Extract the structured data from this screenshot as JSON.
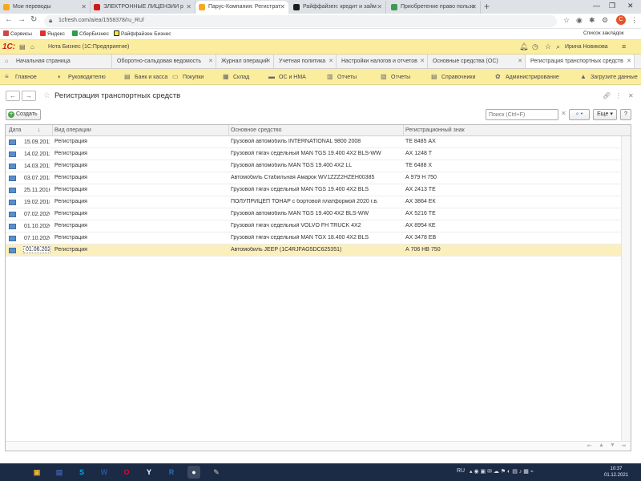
{
  "browser": {
    "tabs": [
      {
        "label": "Мои переводы",
        "color": "#f6a821"
      },
      {
        "label": "ЭЛЕКТРОННЫЕ ЛИЦЕНЗИИ р",
        "color": "#d01818"
      },
      {
        "label": "Парус-Компания: Регистрат",
        "color": "#f6a821"
      },
      {
        "label": "Райффайзен: кредит и займ",
        "color": "#1c1c1c"
      },
      {
        "label": "Приобретение право пользо",
        "color": "#3a9b57"
      }
    ],
    "url": "1cfresh.com/a/ea/1558378/ru_RU/",
    "bookmarks": [
      {
        "label": "Сервисы",
        "color": "#d04848"
      },
      {
        "label": "Яндекс",
        "color": "#e32f2f"
      },
      {
        "label": "СберБизнес",
        "color": "#2c9f4a"
      },
      {
        "label": "Райффайзен Бизнес",
        "color": "#1c1c1c"
      }
    ],
    "other_bookmarks": "Список закладок",
    "avatar_letter": "С"
  },
  "app": {
    "logo": "1С:",
    "title": "Нота Бизнес (1С:Предприятие)",
    "user": "Ирина Новикова"
  },
  "open_windows": [
    "Начальная страница",
    "Оборотно-сальдовая ведомость",
    "Журнал операций",
    "Учетная политика",
    "Настройки налогов и отчетов",
    "Основные средства (ОС)",
    "Регистрация транспортных средств"
  ],
  "sections": [
    {
      "label": "Главное",
      "icon": "≡"
    },
    {
      "label": "Руководителю",
      "icon": "◐"
    },
    {
      "label": "Банк и касса",
      "icon": "▤"
    },
    {
      "label": "Покупки",
      "icon": "🛒"
    },
    {
      "label": "Склад",
      "icon": "▦"
    },
    {
      "label": "ОС и НМА",
      "icon": "▬"
    },
    {
      "label": "Отчеты",
      "icon": "▥"
    },
    {
      "label": "Отчеты",
      "icon": "▧"
    },
    {
      "label": "Справочники",
      "icon": "▤"
    },
    {
      "label": "Администрирование",
      "icon": "✿"
    },
    {
      "label": "Загрузите данные",
      "icon": "▲"
    }
  ],
  "form": {
    "title": "Регистрация транспортных средств",
    "create_label": "Создать",
    "search_placeholder": "Поиск (Ctrl+F)",
    "more_label": "Еще",
    "help_label": "?"
  },
  "table": {
    "columns": [
      "Дата",
      "Вид операции",
      "Основное средство",
      "Регистрационный знак"
    ],
    "rows": [
      {
        "date": "15.09.2011",
        "op": "Регистрация",
        "asset": "Грузовой автомобиль INTERNATIONAL 9800 2008",
        "plate": "ТЕ 8485 АХ"
      },
      {
        "date": "14.02.2012",
        "op": "Регистрация",
        "asset": "Грузовой тягач седельный MAN TGS 19.400 4X2 BLS-WW",
        "plate": "АХ 1248 Т"
      },
      {
        "date": "14.03.2012",
        "op": "Регистрация",
        "asset": "Грузовой автомобиль MAN TGS 19.400 4X2 LL",
        "plate": "ТЕ 6488 Х"
      },
      {
        "date": "03.07.2013",
        "op": "Регистрация",
        "asset": "Автомобиль Стабильная Амарок WV1ZZZ2HZEH00385",
        "plate": "А 979 Н 750"
      },
      {
        "date": "25.11.2016",
        "op": "Регистрация",
        "asset": "Грузовой тягач седельный MAN TGS 19.400 4X2 BLS",
        "plate": "АХ 2413 ТЕ"
      },
      {
        "date": "19.02.2018",
        "op": "Регистрация",
        "asset": "ПОЛУПРИЦЕП ТОНАР с бортовой платформой 2020 г.в.",
        "plate": "АХ 3864 ЕК"
      },
      {
        "date": "07.02.2020",
        "op": "Регистрация",
        "asset": "Грузовой автомобиль MAN TGS 19.400 4X2 BLS-WW",
        "plate": "АХ 5216 ТЕ"
      },
      {
        "date": "01.10.2020",
        "op": "Регистрация",
        "asset": "Грузовой тягач седельный VOLVO FH TRUCK 4X2",
        "plate": "АХ 8954 КЕ"
      },
      {
        "date": "07.10.2020",
        "op": "Регистрация",
        "asset": "Грузовой тягач седельный MAN TGX 18.400 4X2 BLS",
        "plate": "АХ 3478 ЕВ"
      },
      {
        "date": "01.06.2021",
        "op": "Регистрация",
        "asset": "Автомобиль JEEP (1C4RJFAG5DC625351)",
        "plate": "А 706 НВ 750"
      }
    ],
    "selected_index": 9
  },
  "taskbar": {
    "apps": [
      {
        "name": "start",
        "label": "⊞",
        "color": "#1b2a45"
      },
      {
        "name": "explorer",
        "label": "▣",
        "color": "#f0b62c"
      },
      {
        "name": "save",
        "label": "▤",
        "color": "#3a5ea8"
      },
      {
        "name": "skype",
        "label": "S",
        "color": "#00a9e8"
      },
      {
        "name": "word",
        "label": "W",
        "color": "#2b579a"
      },
      {
        "name": "opera",
        "label": "O",
        "color": "#d1102b"
      },
      {
        "name": "yandex",
        "label": "Y",
        "color": "#ffffff"
      },
      {
        "name": "r-app",
        "label": "R",
        "color": "#2a6ebd"
      },
      {
        "name": "chrome",
        "label": "●",
        "color": "#ffffff"
      },
      {
        "name": "tool",
        "label": "✎",
        "color": "#888888"
      }
    ],
    "tray_lang": "RU",
    "time": "10:37",
    "date": "01.12.2021"
  }
}
